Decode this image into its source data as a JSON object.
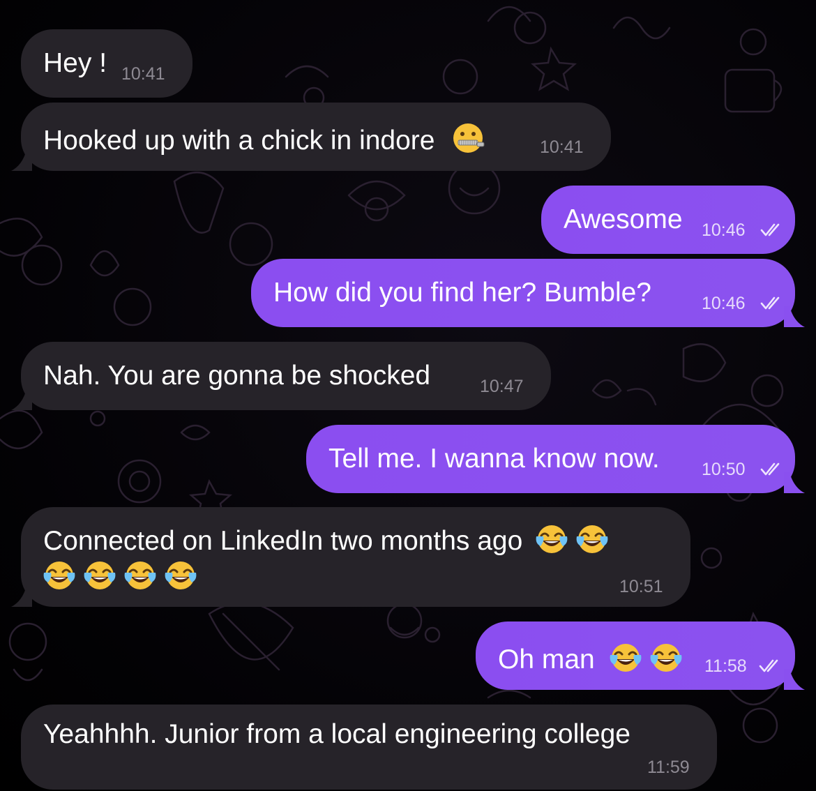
{
  "chat": {
    "messages": [
      {
        "id": "m1",
        "direction": "incoming",
        "text": "Hey !",
        "time": "10:41"
      },
      {
        "id": "m2",
        "direction": "incoming",
        "text": "Hooked up with a chick in indore",
        "emoji": [
          "zipper-mouth-face"
        ],
        "time": "10:41"
      },
      {
        "id": "m3",
        "direction": "outgoing",
        "text": "Awesome",
        "time": "10:46",
        "status": "read"
      },
      {
        "id": "m4",
        "direction": "outgoing",
        "text": "How did you find her? Bumble?",
        "time": "10:46",
        "status": "read"
      },
      {
        "id": "m5",
        "direction": "incoming",
        "text": "Nah. You are gonna be shocked",
        "time": "10:47"
      },
      {
        "id": "m6",
        "direction": "outgoing",
        "text": "Tell me. I wanna know now.",
        "time": "10:50",
        "status": "read"
      },
      {
        "id": "m7",
        "direction": "incoming",
        "text": "Connected on LinkedIn two months ago",
        "emoji": [
          "face-with-tears-of-joy",
          "face-with-tears-of-joy",
          "face-with-tears-of-joy",
          "face-with-tears-of-joy",
          "face-with-tears-of-joy",
          "face-with-tears-of-joy"
        ],
        "time": "10:51"
      },
      {
        "id": "m8",
        "direction": "outgoing",
        "text": "Oh man",
        "emoji": [
          "face-with-tears-of-joy",
          "face-with-tears-of-joy"
        ],
        "time": "11:58",
        "status": "read"
      },
      {
        "id": "m9",
        "direction": "incoming",
        "text": "Yeahhhh. Junior from a local engineering college",
        "time": "11:59"
      }
    ]
  },
  "colors": {
    "incoming_bubble": "#262329",
    "outgoing_bubble": "#8a50ef",
    "background": "#000000"
  }
}
